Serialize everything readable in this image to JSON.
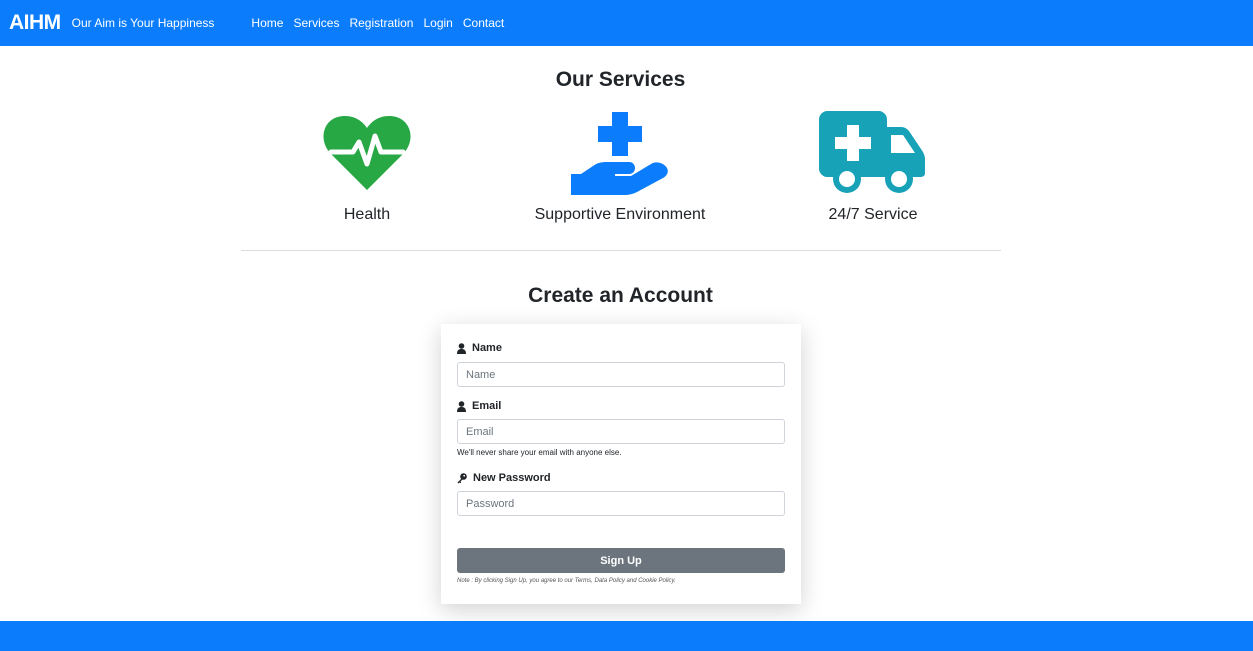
{
  "navbar": {
    "brand": "AIHM",
    "tagline": "Our Aim is Your Happiness",
    "links": [
      "Home",
      "Services",
      "Registration",
      "Login",
      "Contact"
    ]
  },
  "services": {
    "title": "Our Services",
    "items": [
      {
        "label": "Health",
        "icon": "heartbeat-icon",
        "color": "#28a745"
      },
      {
        "label": "Supportive Environment",
        "icon": "hand-holding-medical-icon",
        "color": "#0b7dfc"
      },
      {
        "label": "24/7 Service",
        "icon": "ambulance-icon",
        "color": "#17a2b8"
      }
    ]
  },
  "form": {
    "title": "Create an Account",
    "name_label": "Name",
    "name_placeholder": "Name",
    "email_label": "Email",
    "email_placeholder": "Email",
    "email_help": "We'll never share your email with anyone else.",
    "password_label": "New Password",
    "password_placeholder": "Password",
    "submit_label": "Sign Up",
    "note": "Note : By clicking Sign Up, you agree to our Terms, Data Policy and Cookie Policy."
  },
  "colors": {
    "primary": "#0b7dfc",
    "button": "#6c757d"
  }
}
